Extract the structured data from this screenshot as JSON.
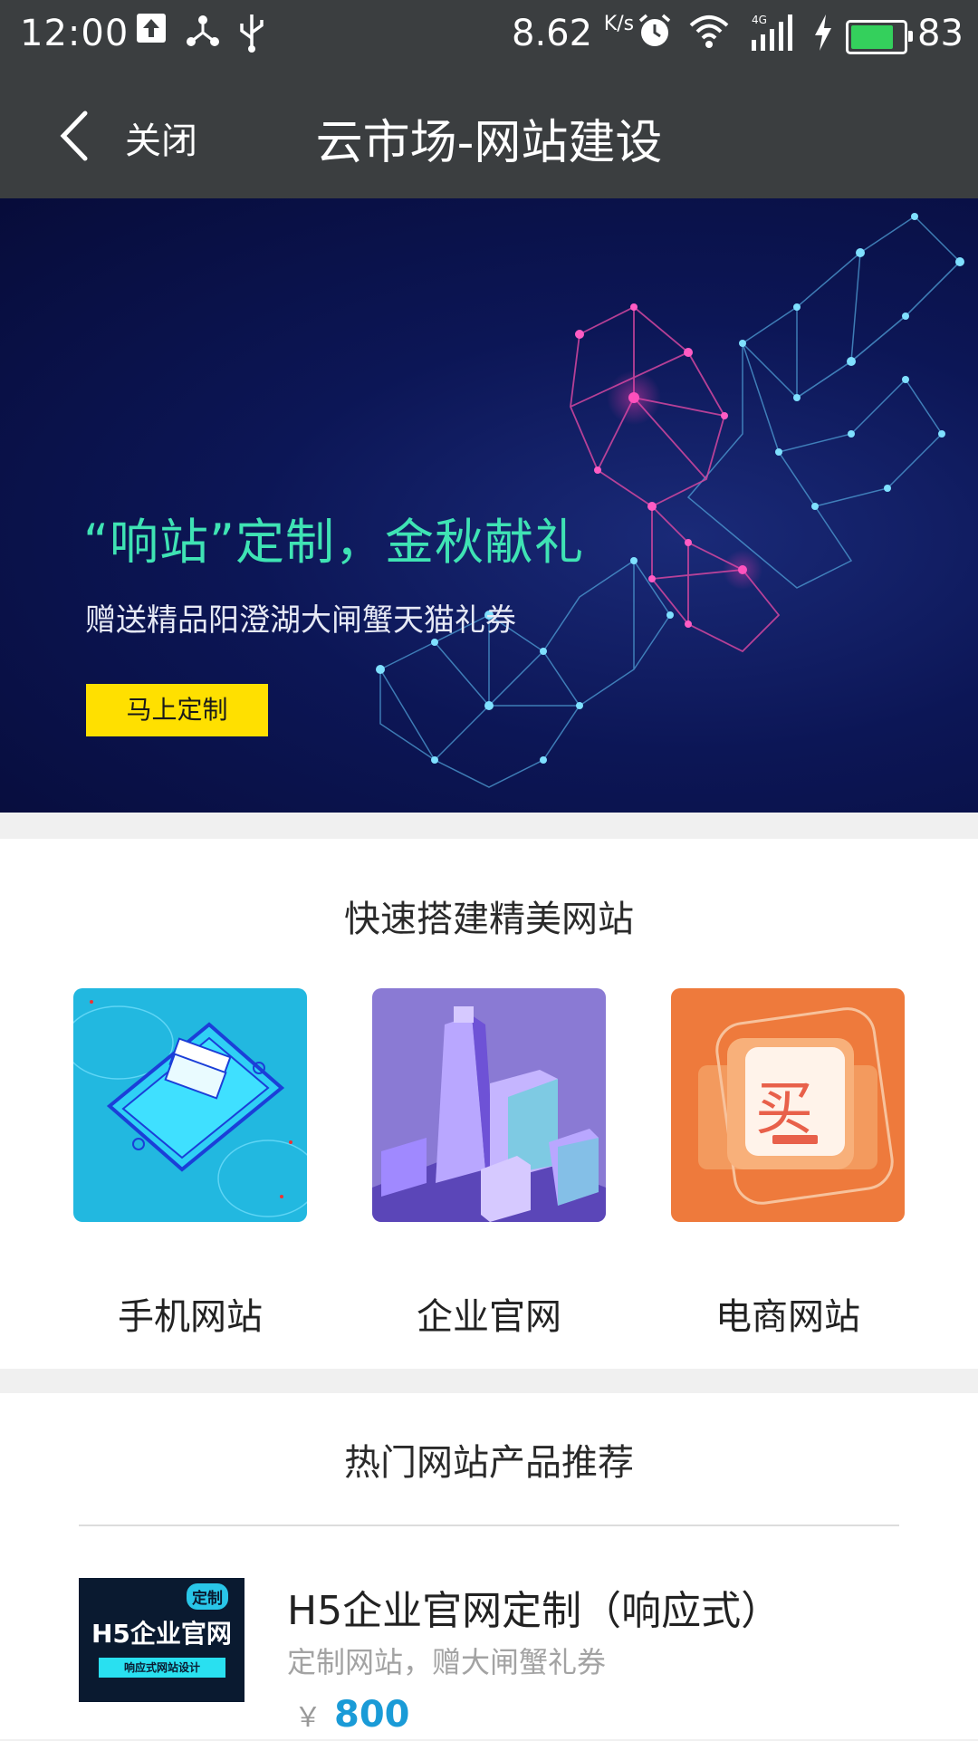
{
  "status_bar": {
    "time": "12:00",
    "net_speed": "8.62",
    "net_speed_unit": "K/s",
    "battery_level": "83",
    "battery_fraction": 0.83,
    "icons": [
      "upload-icon",
      "share-icon",
      "usb-icon",
      "alarm-icon",
      "wifi-icon",
      "4g-signal-icon",
      "charging-icon",
      "battery-icon"
    ]
  },
  "nav": {
    "close_label": "关闭",
    "title": "云市场-网站建设"
  },
  "banner": {
    "headline": "“响站”定制，金秋献礼",
    "subtitle": "赠送精品阳澄湖大闸蟹天猫礼券",
    "cta": "马上定制"
  },
  "quick_build": {
    "title": "快速搭建精美网站",
    "tiles": [
      {
        "label": "手机网站",
        "color": "#22b8e0"
      },
      {
        "label": "企业官网",
        "color": "#8a7ad4"
      },
      {
        "label": "电商网站",
        "color": "#ee7a3c",
        "art_text": "买"
      }
    ]
  },
  "hot": {
    "title": "热门网站产品推荐",
    "products": [
      {
        "image_text": "H5企业官网",
        "image_tag": "定制",
        "image_caption": "响应式网站设计",
        "title": "H5企业官网定制（响应式）",
        "subtitle": "定制网站，赠大闸蟹礼券",
        "currency": "￥",
        "price": "800"
      }
    ]
  },
  "colors": {
    "bar_bg": "#3b3e40",
    "banner_headline": "#3fe3b4",
    "cta_bg": "#ffe000",
    "price": "#1a9bd7"
  }
}
